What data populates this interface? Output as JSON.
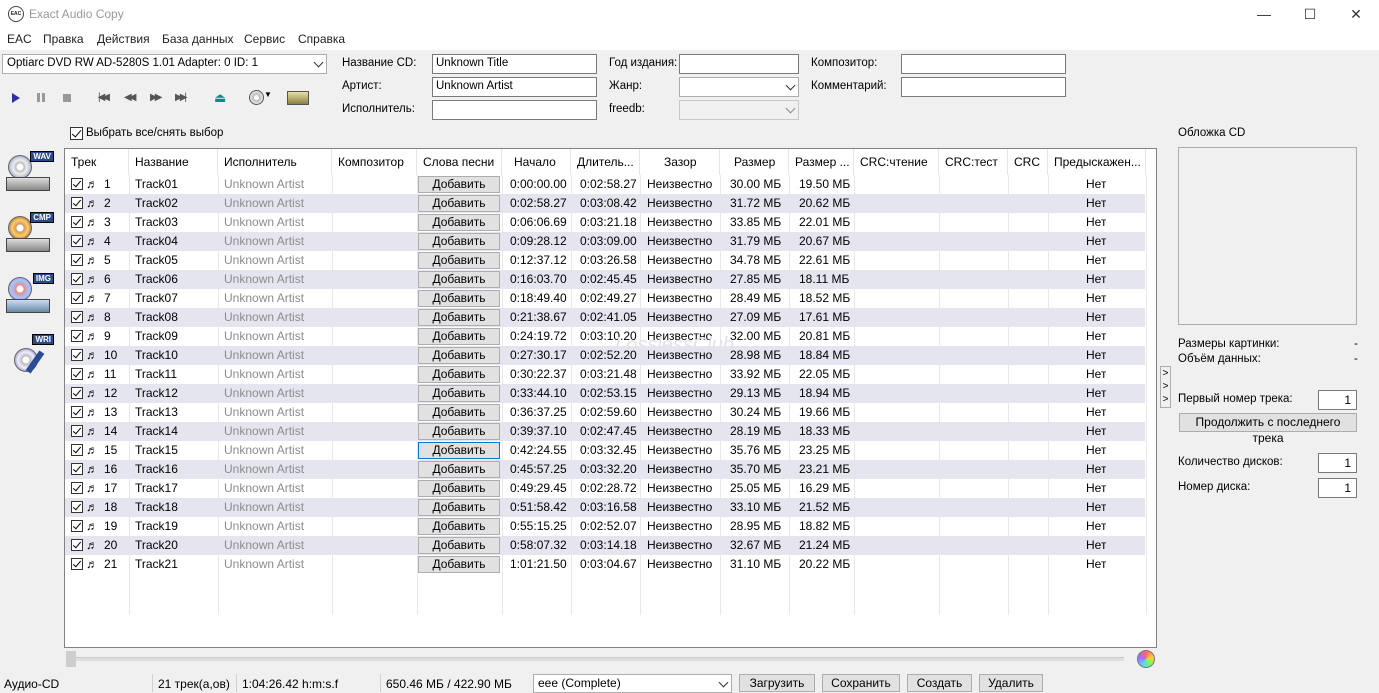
{
  "window": {
    "title": "Exact Audio Copy",
    "icon_text": "EAC",
    "controls": {
      "minimize": "—",
      "maximize": "☐",
      "close": "✕"
    }
  },
  "menu": [
    "EAC",
    "Правка",
    "Действия",
    "База данных",
    "Сервис",
    "Справка"
  ],
  "drive": {
    "selected": "Optiarc DVD RW AD-5280S 1.01  Adapter: 0  ID: 1"
  },
  "toolbar": {
    "icons": [
      "play-icon",
      "pause-icon",
      "stop-icon",
      "previous-track-icon",
      "rewind-icon",
      "fast-forward-icon",
      "next-track-icon",
      "eject-icon",
      "cd-options-icon",
      "drive-icon"
    ]
  },
  "metadata": {
    "cd_title_label": "Название CD:",
    "cd_title_value": "Unknown Title",
    "artist_label": "Артист:",
    "artist_value": "Unknown Artist",
    "performer_label": "Исполнитель:",
    "performer_value": "",
    "year_label": "Год издания:",
    "year_value": "",
    "genre_label": "Жанр:",
    "genre_value": "",
    "freedb_label": "freedb:",
    "freedb_value": "",
    "composer_label": "Композитор:",
    "composer_value": "",
    "comment_label": "Комментарий:",
    "comment_value": ""
  },
  "select_all_label": "Выбрать все/снять выбор",
  "side_icons": [
    "WAV",
    "CMP",
    "IMG",
    "WRI"
  ],
  "table": {
    "columns": [
      "Трек",
      "Название",
      "Исполнитель",
      "Композитор",
      "Слова песни",
      "Начало",
      "Длитель...",
      "Зазор",
      "Размер",
      "Размер ...",
      "CRC:чтение",
      "CRC:тест",
      "CRC",
      "Предыскажен..."
    ],
    "add_label": "Добавить",
    "rows": [
      {
        "n": "1",
        "title": "Track01",
        "artist": "Unknown Artist",
        "start": "0:00:00.00",
        "length": "0:02:58.27",
        "gap": "Неизвестно",
        "size": "30.00 МБ",
        "csize": "19.50 МБ",
        "pre": "Нет"
      },
      {
        "n": "2",
        "title": "Track02",
        "artist": "Unknown Artist",
        "start": "0:02:58.27",
        "length": "0:03:08.42",
        "gap": "Неизвестно",
        "size": "31.72 МБ",
        "csize": "20.62 МБ",
        "pre": "Нет"
      },
      {
        "n": "3",
        "title": "Track03",
        "artist": "Unknown Artist",
        "start": "0:06:06.69",
        "length": "0:03:21.18",
        "gap": "Неизвестно",
        "size": "33.85 МБ",
        "csize": "22.01 МБ",
        "pre": "Нет"
      },
      {
        "n": "4",
        "title": "Track04",
        "artist": "Unknown Artist",
        "start": "0:09:28.12",
        "length": "0:03:09.00",
        "gap": "Неизвестно",
        "size": "31.79 МБ",
        "csize": "20.67 МБ",
        "pre": "Нет"
      },
      {
        "n": "5",
        "title": "Track05",
        "artist": "Unknown Artist",
        "start": "0:12:37.12",
        "length": "0:03:26.58",
        "gap": "Неизвестно",
        "size": "34.78 МБ",
        "csize": "22.61 МБ",
        "pre": "Нет"
      },
      {
        "n": "6",
        "title": "Track06",
        "artist": "Unknown Artist",
        "start": "0:16:03.70",
        "length": "0:02:45.45",
        "gap": "Неизвестно",
        "size": "27.85 МБ",
        "csize": "18.11 МБ",
        "pre": "Нет"
      },
      {
        "n": "7",
        "title": "Track07",
        "artist": "Unknown Artist",
        "start": "0:18:49.40",
        "length": "0:02:49.27",
        "gap": "Неизвестно",
        "size": "28.49 МБ",
        "csize": "18.52 МБ",
        "pre": "Нет"
      },
      {
        "n": "8",
        "title": "Track08",
        "artist": "Unknown Artist",
        "start": "0:21:38.67",
        "length": "0:02:41.05",
        "gap": "Неизвестно",
        "size": "27.09 МБ",
        "csize": "17.61 МБ",
        "pre": "Нет"
      },
      {
        "n": "9",
        "title": "Track09",
        "artist": "Unknown Artist",
        "start": "0:24:19.72",
        "length": "0:03:10.20",
        "gap": "Неизвестно",
        "size": "32.00 МБ",
        "csize": "20.81 МБ",
        "pre": "Нет"
      },
      {
        "n": "10",
        "title": "Track10",
        "artist": "Unknown Artist",
        "start": "0:27:30.17",
        "length": "0:02:52.20",
        "gap": "Неизвестно",
        "size": "28.98 МБ",
        "csize": "18.84 МБ",
        "pre": "Нет"
      },
      {
        "n": "11",
        "title": "Track11",
        "artist": "Unknown Artist",
        "start": "0:30:22.37",
        "length": "0:03:21.48",
        "gap": "Неизвестно",
        "size": "33.92 МБ",
        "csize": "22.05 МБ",
        "pre": "Нет"
      },
      {
        "n": "12",
        "title": "Track12",
        "artist": "Unknown Artist",
        "start": "0:33:44.10",
        "length": "0:02:53.15",
        "gap": "Неизвестно",
        "size": "29.13 МБ",
        "csize": "18.94 МБ",
        "pre": "Нет"
      },
      {
        "n": "13",
        "title": "Track13",
        "artist": "Unknown Artist",
        "start": "0:36:37.25",
        "length": "0:02:59.60",
        "gap": "Неизвестно",
        "size": "30.24 МБ",
        "csize": "19.66 МБ",
        "pre": "Нет"
      },
      {
        "n": "14",
        "title": "Track14",
        "artist": "Unknown Artist",
        "start": "0:39:37.10",
        "length": "0:02:47.45",
        "gap": "Неизвестно",
        "size": "28.19 МБ",
        "csize": "18.33 МБ",
        "pre": "Нет"
      },
      {
        "n": "15",
        "title": "Track15",
        "artist": "Unknown Artist",
        "start": "0:42:24.55",
        "length": "0:03:32.45",
        "gap": "Неизвестно",
        "size": "35.76 МБ",
        "csize": "23.25 МБ",
        "pre": "Нет"
      },
      {
        "n": "16",
        "title": "Track16",
        "artist": "Unknown Artist",
        "start": "0:45:57.25",
        "length": "0:03:32.20",
        "gap": "Неизвестно",
        "size": "35.70 МБ",
        "csize": "23.21 МБ",
        "pre": "Нет"
      },
      {
        "n": "17",
        "title": "Track17",
        "artist": "Unknown Artist",
        "start": "0:49:29.45",
        "length": "0:02:28.72",
        "gap": "Неизвестно",
        "size": "25.05 МБ",
        "csize": "16.29 МБ",
        "pre": "Нет"
      },
      {
        "n": "18",
        "title": "Track18",
        "artist": "Unknown Artist",
        "start": "0:51:58.42",
        "length": "0:03:16.58",
        "gap": "Неизвестно",
        "size": "33.10 МБ",
        "csize": "21.52 МБ",
        "pre": "Нет"
      },
      {
        "n": "19",
        "title": "Track19",
        "artist": "Unknown Artist",
        "start": "0:55:15.25",
        "length": "0:02:52.07",
        "gap": "Неизвестно",
        "size": "28.95 МБ",
        "csize": "18.82 МБ",
        "pre": "Нет"
      },
      {
        "n": "20",
        "title": "Track20",
        "artist": "Unknown Artist",
        "start": "0:58:07.32",
        "length": "0:03:14.18",
        "gap": "Неизвестно",
        "size": "32.67 МБ",
        "csize": "21.24 МБ",
        "pre": "Нет"
      },
      {
        "n": "21",
        "title": "Track21",
        "artist": "Unknown Artist",
        "start": "1:01:21.50",
        "length": "0:03:04.67",
        "gap": "Неизвестно",
        "size": "31.10 МБ",
        "csize": "20.22 МБ",
        "pre": "Нет"
      }
    ]
  },
  "right_panel": {
    "cover_label": "Обложка CD",
    "image_size_label": "Размеры картинки:",
    "image_size_value": "-",
    "data_volume_label": "Объём данных:",
    "data_volume_value": "-",
    "first_track_label": "Первый номер трека:",
    "first_track_value": "1",
    "continue_button": "Продолжить с последнего трека",
    "disc_count_label": "Количество дисков:",
    "disc_count_value": "1",
    "disc_number_label": "Номер диска:",
    "disc_number_value": "1"
  },
  "status": {
    "mode": "Аудио-CD",
    "tracks": "21 трек(а,ов)",
    "duration": "1:04:26.42 h:m:s.f",
    "size": "650.46 МБ / 422.90 МБ",
    "profile": "eee  (Complete)",
    "load_button": "Загрузить",
    "save_button": "Сохранить",
    "create_button": "Создать",
    "delete_button": "Удалить"
  },
  "watermark": "LosslessClub",
  "colors": {
    "row_alt": "#e5e5f0",
    "artist_gray": "#8c8c8c",
    "focus_blue": "#0078d7"
  }
}
